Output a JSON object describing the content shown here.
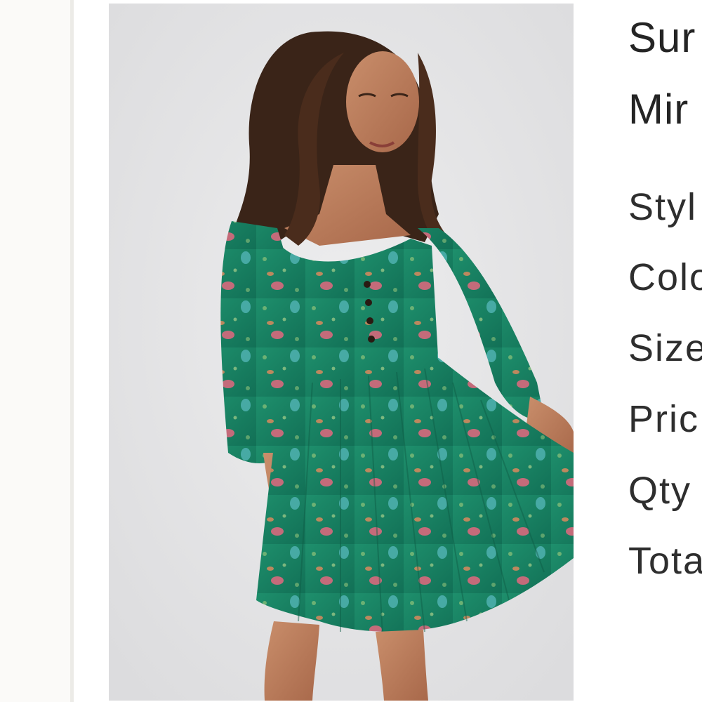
{
  "product": {
    "title_line_1": "Sur",
    "title_line_2": "Mir",
    "image_alt": "Model wearing green floral print mini dress"
  },
  "details": {
    "rows": [
      {
        "label": "Styl"
      },
      {
        "label": "Colo"
      },
      {
        "label": "Size"
      },
      {
        "label": "Pric"
      },
      {
        "label": "Qty"
      },
      {
        "label": "Tota"
      }
    ]
  },
  "colors": {
    "dress_green": "#1f8a6a",
    "accent_pink": "#d86a7e",
    "background_gray": "#e6e6e8"
  }
}
